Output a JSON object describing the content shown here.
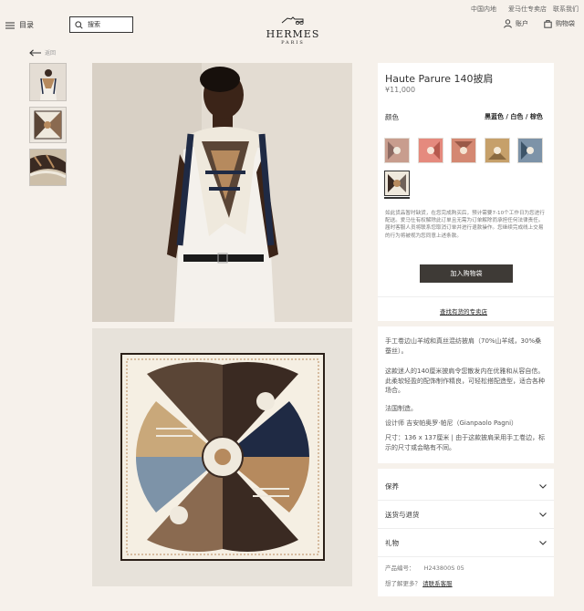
{
  "top_links": [
    "中国内地",
    "爱马仕专卖店",
    "联系我们"
  ],
  "header": {
    "menu_label": "目录",
    "search_placeholder": "搜索",
    "logo_name": "HERMES",
    "logo_city": "PARIS",
    "account_label": "账户",
    "cart_label": "购物袋"
  },
  "back_label": "返回",
  "product": {
    "title": "Haute Parure 140披肩",
    "price": "¥11,000",
    "color_label": "颜色",
    "color_value": "黑蓝色 / 白色 / 棕色",
    "notice": "如此货品暂时缺货，在您完成购买后，预计需要7-10个工作日为您进行配送。爱马仕有权解除此订单且无需为订单解除而承担任何法律责任。届时客服人员将联系您取消订单并进行退款操作。您继续完成线上交易的行为将被视为您同意上述条款。",
    "add_to_bag": "加入购物袋",
    "find_store": "查找有货的专卖店"
  },
  "colors": {
    "swatches": [
      "#c89d8e",
      "#e58a7e",
      "#d48872",
      "#c6a06a",
      "#7d93a8",
      "#6f625a"
    ],
    "scarf_dark": "#3a2a22",
    "scarf_blue": "#1f2a44",
    "scarf_cream": "#efe9dd",
    "scarf_tan": "#b68a5e"
  },
  "description": {
    "p1": "手工卷边山羊绒和真丝混纺披肩（70%山羊绒，30%桑蚕丝）。",
    "p2": "这款迷人的140厘米披肩令您散发内在优雅和从容自信。此柔软轻盈的配饰制作精良，可轻松搭配造型，适合各种场合。",
    "p3": "法国制造。",
    "p4": "设计师 吉安帕奥罗·帕尼（Gianpaolo Pagni）",
    "p5": "尺寸：136 x 137厘米 | 由于这款披肩采用手工卷边，标示的尺寸或会略有不同。"
  },
  "accordion": [
    "保养",
    "送货与退货",
    "礼物"
  ],
  "meta": {
    "product_code_label": "产品编号：",
    "product_code": "H243800S 05",
    "more_q": "想了解更多？",
    "contact": "请联系客服"
  }
}
